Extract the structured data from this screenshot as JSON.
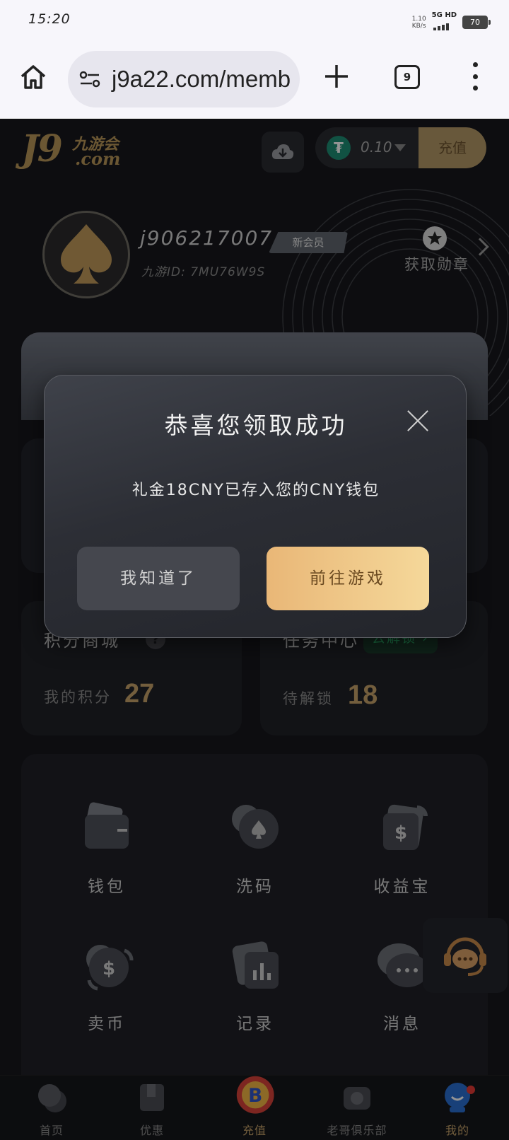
{
  "status_bar": {
    "time": "15:20",
    "net_speed_value": "1.10",
    "net_speed_unit": "KB/s",
    "network": "5G HD",
    "battery": "70"
  },
  "browser": {
    "url": "j9a22.com/memb",
    "tab_count": "9"
  },
  "header": {
    "logo_main": "J9",
    "logo_cn": "九游会",
    "logo_com": ".com",
    "balance": "0.10",
    "recharge_label": "充值"
  },
  "profile": {
    "username": "j906217007",
    "member_badge": "新会员",
    "user_id": "九游ID: 7MU76W9S",
    "medal_label": "获取勋章"
  },
  "points_card": {
    "title": "积分商城",
    "help_icon": "?",
    "sub_label": "我的积分",
    "value": "27"
  },
  "task_card": {
    "title": "任务中心",
    "unlock_label": "去解锁",
    "sub_label": "待解锁",
    "value": "18"
  },
  "grid": {
    "items": [
      {
        "label": "钱包",
        "icon": "wallet-icon"
      },
      {
        "label": "洗码",
        "icon": "chip-icon"
      },
      {
        "label": "收益宝",
        "icon": "earnings-icon"
      },
      {
        "label": "卖币",
        "icon": "sell-coin-icon"
      },
      {
        "label": "记录",
        "icon": "records-icon"
      },
      {
        "label": "消息",
        "icon": "messages-icon"
      }
    ]
  },
  "bottom_nav": {
    "items": [
      {
        "label": "首页"
      },
      {
        "label": "优惠"
      },
      {
        "label": "充值"
      },
      {
        "label": "老哥俱乐部"
      },
      {
        "label": "我的"
      }
    ]
  },
  "modal": {
    "title": "恭喜您领取成功",
    "message": "礼金18CNY已存入您的CNY钱包",
    "secondary_button": "我知道了",
    "primary_button": "前往游戏"
  },
  "colors": {
    "accent_gold": "#c7a36a",
    "primary_button_gradient_start": "#e9b777",
    "primary_button_gradient_end": "#f5d89a",
    "unlock_green": "#2bb36b",
    "tether_green": "#1e8d74"
  }
}
